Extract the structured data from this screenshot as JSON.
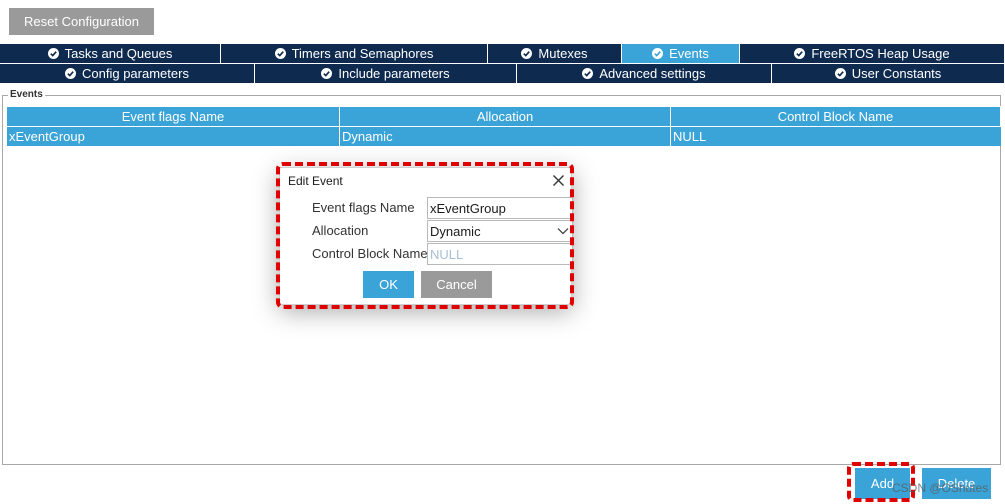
{
  "toolbar": {
    "reset_label": "Reset Configuration"
  },
  "tabs_row1": [
    {
      "label": "Tasks and Queues",
      "active": false
    },
    {
      "label": "Timers and Semaphores",
      "active": false
    },
    {
      "label": "Mutexes",
      "active": false
    },
    {
      "label": "Events",
      "active": true
    },
    {
      "label": "FreeRTOS Heap Usage",
      "active": false
    }
  ],
  "tabs_row2": [
    {
      "label": "Config parameters"
    },
    {
      "label": "Include parameters"
    },
    {
      "label": "Advanced settings"
    },
    {
      "label": "User Constants"
    }
  ],
  "tab_icon": "check-circle-icon",
  "panel": {
    "legend": "Events",
    "columns": [
      "Event flags Name",
      "Allocation",
      "Control Block Name"
    ],
    "rows": [
      [
        "xEventGroup",
        "Dynamic",
        "NULL"
      ]
    ]
  },
  "dialog": {
    "title": "Edit Event",
    "close_icon": "close-icon",
    "fields": [
      {
        "label": "Event flags Name",
        "value": "xEventGroup"
      },
      {
        "label": "Allocation",
        "value": "Dynamic"
      },
      {
        "label": "Control Block Name",
        "placeholder": "NULL"
      }
    ],
    "ok_label": "OK",
    "cancel_label": "Cancel"
  },
  "footer": {
    "add_label": "Add",
    "delete_label": "Delete"
  },
  "watermark": "CSDN @OShutes",
  "colors": {
    "accent": "#3aa3d8",
    "tab_dark": "#0e2a4f",
    "button_gray": "#9a9a9a",
    "highlight_red": "#e00000"
  }
}
